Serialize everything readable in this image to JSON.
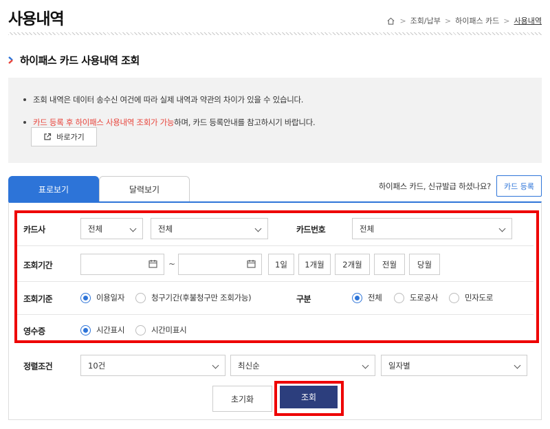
{
  "page": {
    "title": "사용내역"
  },
  "breadcrumb": {
    "items": [
      "조회/납부",
      "하이패스 카드",
      "사용내역"
    ]
  },
  "section": {
    "title": "하이패스 카드 사용내역 조회"
  },
  "notice": {
    "line1": "조회 내역은 데이터 송수신 여건에 따라 실제 내역과 약관의 차이가 있을 수 있습니다.",
    "line2_red": "카드 등록 후 하이패스 사용내역 조회가 가능",
    "line2_rest": "하며, 카드 등록안내를 참고하시기 바랍니다.",
    "goto_label": "바로가기"
  },
  "tabs": [
    {
      "label": "표로보기",
      "active": true
    },
    {
      "label": "달력보기",
      "active": false
    }
  ],
  "register": {
    "question": "하이패스 카드, 신규발급 하셨나요?",
    "button_label": "카드 등록"
  },
  "form": {
    "card_company": {
      "label": "카드사",
      "select1": "전체",
      "select2": "전체"
    },
    "card_number": {
      "label": "카드번호",
      "value": "전체"
    },
    "period": {
      "label": "조회기간",
      "start_date": "",
      "end_date": "",
      "separator": "~",
      "quick_buttons": [
        "1일",
        "1개월",
        "2개월",
        "전월",
        "당월"
      ]
    },
    "criteria": {
      "label": "조회기준",
      "options": [
        "이용일자",
        "청구기간(후불청구만 조회가능)"
      ],
      "selected": "이용일자"
    },
    "division": {
      "label": "구분",
      "options": [
        "전체",
        "도로공사",
        "민자도로"
      ],
      "selected": "전체"
    },
    "receipt": {
      "label": "영수증",
      "options": [
        "시간표시",
        "시간미표시"
      ],
      "selected": "시간표시"
    },
    "sort": {
      "label": "정렬조건",
      "count": "10건",
      "order": "최신순",
      "group": "일자별"
    }
  },
  "actions": {
    "reset_label": "초기화",
    "search_label": "조회"
  },
  "colors": {
    "accent": "#2d74d8",
    "primary_button": "#2c3e7d",
    "highlight": "#e00000",
    "notice_red": "#e8443b"
  }
}
